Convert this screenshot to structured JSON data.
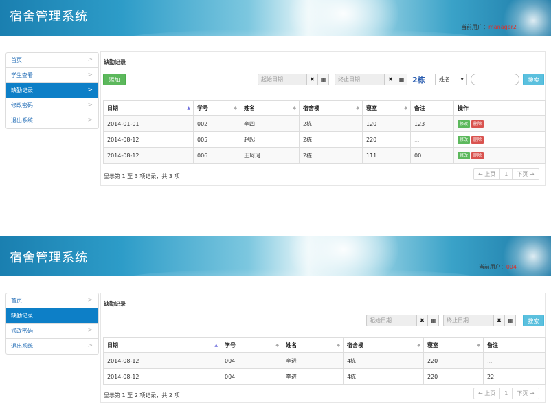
{
  "screen1": {
    "header": {
      "brand": "宿舍管理系统",
      "user_label": "当前用户：",
      "user_name": "manager2"
    },
    "sidebar": [
      {
        "label": "首页",
        "active": false
      },
      {
        "label": "学生查看",
        "active": false
      },
      {
        "label": "缺勤记录",
        "active": true
      },
      {
        "label": "修改密码",
        "active": false
      },
      {
        "label": "退出系统",
        "active": false
      }
    ],
    "panel": {
      "title": "缺勤记录",
      "add_label": "添加",
      "start_placeholder": "起始日期",
      "end_placeholder": "终止日期",
      "clear_icon": "✖",
      "calendar_icon": "▦",
      "building": "2栋",
      "search_field": "姓名",
      "search_label": "搜索",
      "columns": [
        "日期",
        "学号",
        "姓名",
        "宿舍楼",
        "寝室",
        "备注",
        "操作"
      ],
      "rows": [
        [
          "2014-01-01",
          "002",
          "李四",
          "2栋",
          "120",
          "123"
        ],
        [
          "2014-08-12",
          "005",
          "赵起",
          "2栋",
          "220",
          "..."
        ],
        [
          "2014-08-12",
          "006",
          "王珂珂",
          "2栋",
          "111",
          "00"
        ]
      ],
      "edit_label": "修改",
      "delete_label": "删除",
      "info": "显示第 1 至 3 项记录，共 3 项",
      "pager": {
        "prev": "← 上页",
        "page": "1",
        "next": "下页 →"
      }
    }
  },
  "screen2": {
    "header": {
      "brand": "宿舍管理系统",
      "user_label": "当前用户：",
      "user_name": "004"
    },
    "sidebar": [
      {
        "label": "首页",
        "active": false
      },
      {
        "label": "缺勤记录",
        "active": true
      },
      {
        "label": "修改密码",
        "active": false
      },
      {
        "label": "退出系统",
        "active": false
      }
    ],
    "panel": {
      "title": "缺勤记录",
      "start_placeholder": "起始日期",
      "end_placeholder": "终止日期",
      "clear_icon": "✖",
      "calendar_icon": "▦",
      "search_label": "搜索",
      "columns": [
        "日期",
        "学号",
        "姓名",
        "宿舍楼",
        "寝室",
        "备注"
      ],
      "rows": [
        [
          "2014-08-12",
          "004",
          "李进",
          "4栋",
          "220",
          "..."
        ],
        [
          "2014-08-12",
          "004",
          "李进",
          "4栋",
          "220",
          "22"
        ]
      ],
      "info": "显示第 1 至 2 项记录，共 2 项",
      "pager": {
        "prev": "← 上页",
        "page": "1",
        "next": "下页 →"
      }
    }
  }
}
